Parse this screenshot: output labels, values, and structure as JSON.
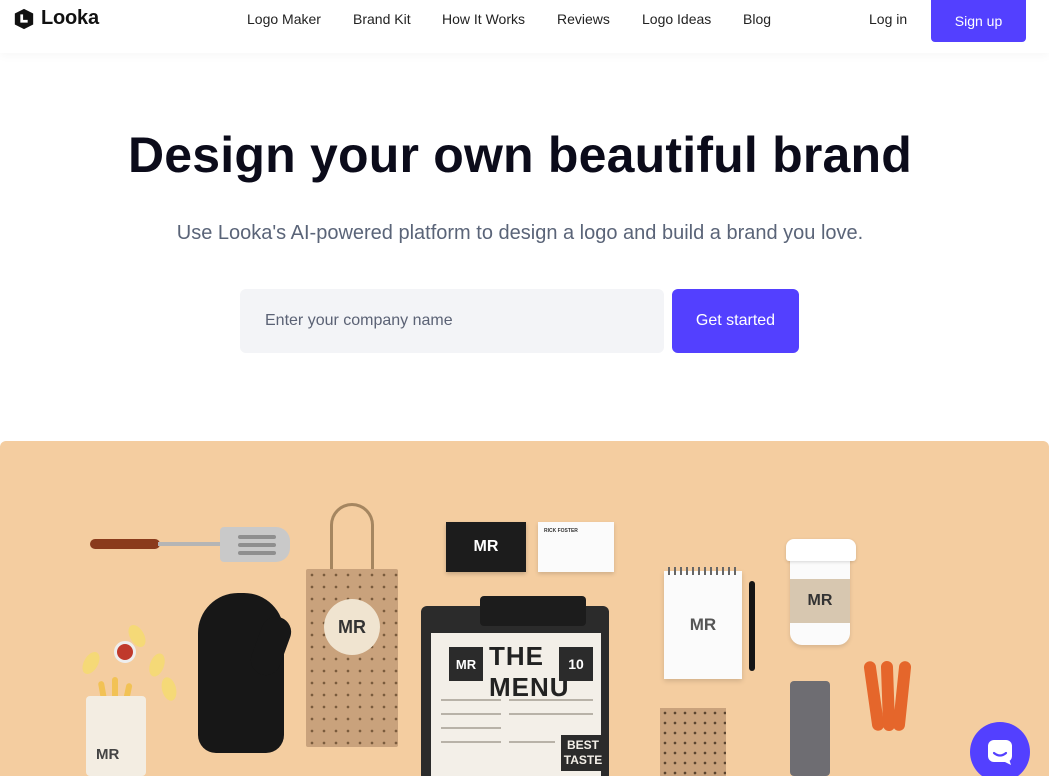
{
  "brand": {
    "name": "Looka"
  },
  "nav": {
    "items": [
      {
        "label": "Logo Maker",
        "name": "nav-logo-maker"
      },
      {
        "label": "Brand Kit",
        "name": "nav-brand-kit"
      },
      {
        "label": "How It Works",
        "name": "nav-how-it-works"
      },
      {
        "label": "Reviews",
        "name": "nav-reviews"
      },
      {
        "label": "Logo Ideas",
        "name": "nav-logo-ideas"
      },
      {
        "label": "Blog",
        "name": "nav-blog"
      }
    ],
    "login_label": "Log in",
    "signup_label": "Sign up"
  },
  "hero": {
    "title": "Design your own beautiful brand",
    "subtitle": "Use Looka's AI-powered platform to design a logo and build a brand you love.",
    "input_placeholder": "Enter your company name",
    "input_value": "",
    "cta_label": "Get started"
  },
  "showcase": {
    "monogram": "MR",
    "menu_title": "THE MENU",
    "menu_number": "10",
    "best_taste": "BEST TASTE",
    "card_name": "RICK FOSTER"
  },
  "colors": {
    "accent": "#5340ff",
    "showcase_bg": "#f4cda0",
    "title": "#0b0b1a",
    "subtitle": "#5a6478"
  },
  "icons": {
    "logo": "looka-logo-icon",
    "chat": "chat-bubble-icon"
  }
}
